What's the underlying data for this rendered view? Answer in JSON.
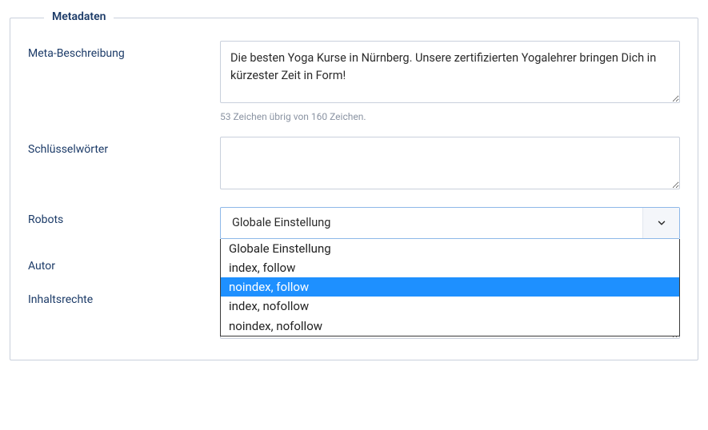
{
  "metadata": {
    "legend": "Metadaten",
    "metaDescription": {
      "label": "Meta-Beschreibung",
      "value": "Die besten Yoga Kurse in Nürnberg. Unsere zertifizierten Yogalehrer bringen Dich in kürzester Zeit in Form!",
      "helper": "53 Zeichen übrig von 160 Zeichen."
    },
    "keywords": {
      "label": "Schlüsselwörter",
      "value": ""
    },
    "robots": {
      "label": "Robots",
      "selected": "Globale Einstellung",
      "options": {
        "0": "Globale Einstellung",
        "1": "index, follow",
        "2": "noindex, follow",
        "3": "index, nofollow",
        "4": "noindex, nofollow"
      },
      "highlightedIndex": 2
    },
    "author": {
      "label": "Autor",
      "value": ""
    },
    "rights": {
      "label": "Inhaltsrechte",
      "value": ""
    }
  }
}
